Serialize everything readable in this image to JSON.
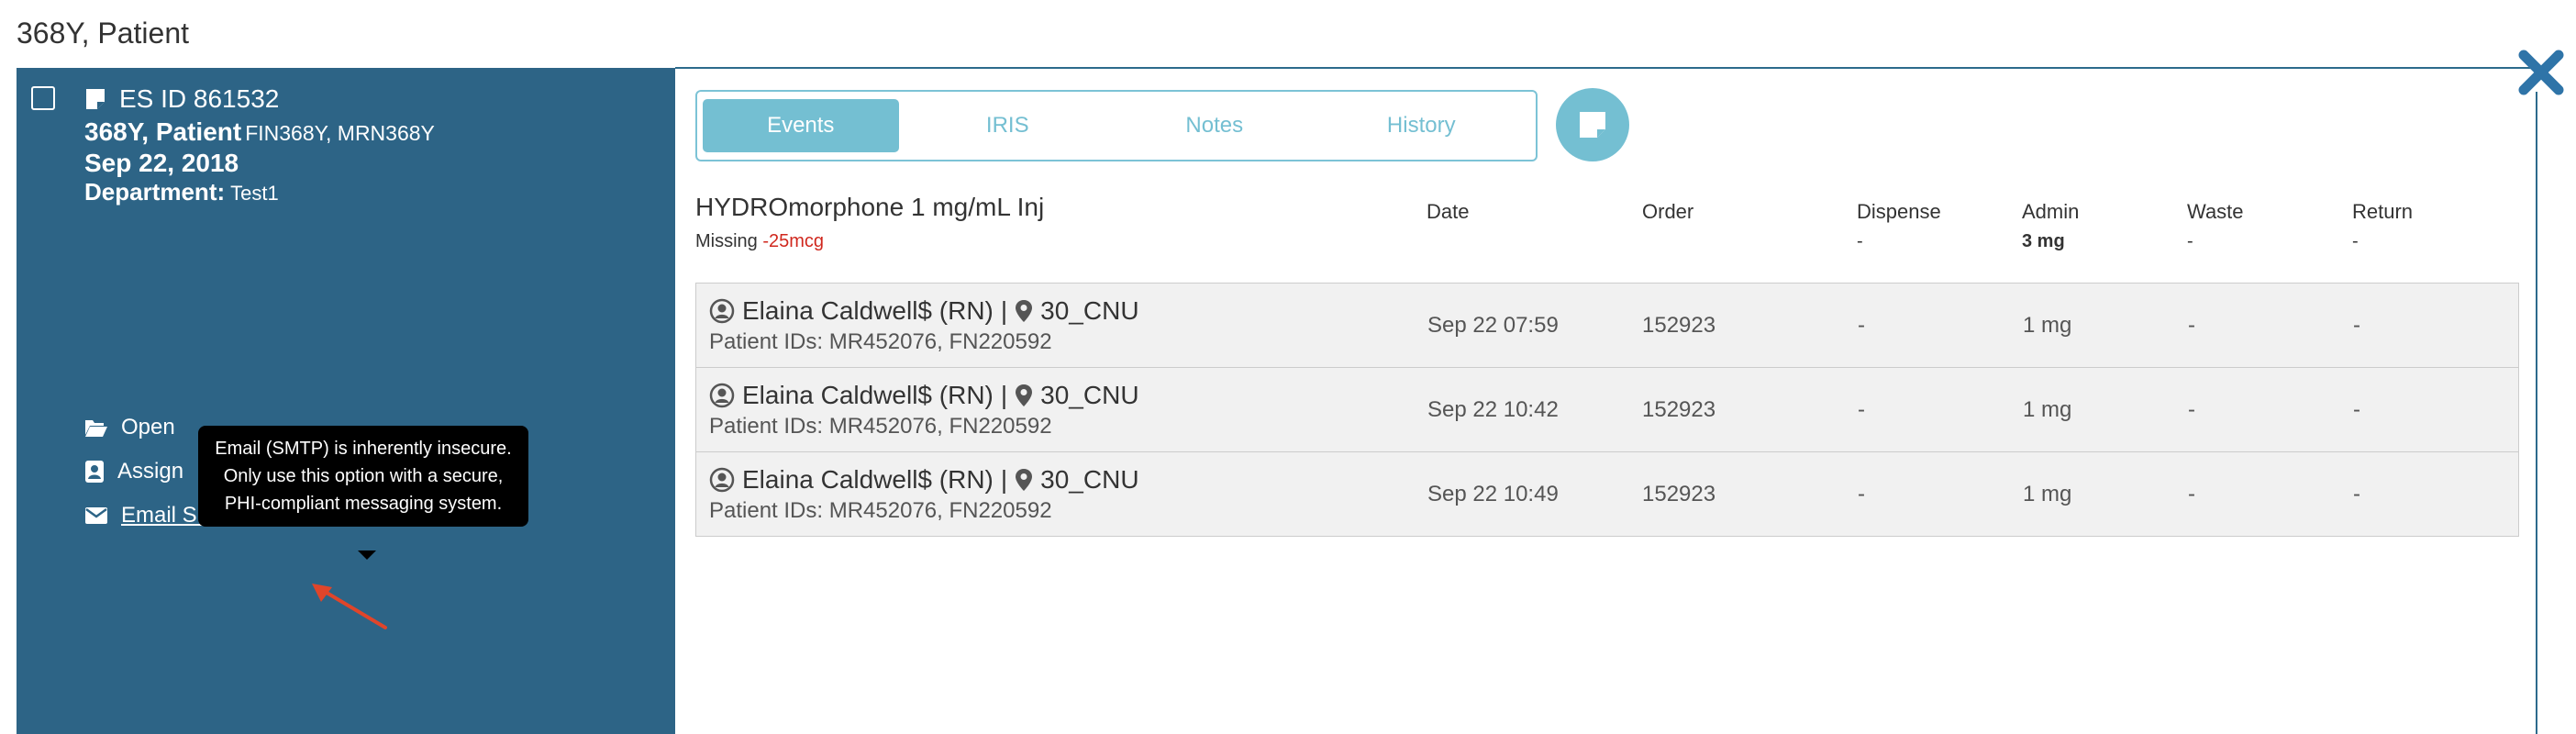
{
  "page": {
    "title": "368Y, Patient"
  },
  "sidebar": {
    "es_id": "ES ID 861532",
    "patient_name": "368Y, Patient",
    "patient_ids": "FIN368Y, MRN368Y",
    "date": "Sep 22, 2018",
    "department_label": "Department:",
    "department_value": "Test1",
    "actions": [
      {
        "label": "Open",
        "icon": "folder-open-icon"
      },
      {
        "label": "Assign",
        "icon": "assign-icon"
      },
      {
        "label": "Email Summary",
        "icon": "envelope-icon"
      }
    ],
    "tooltip": "Email (SMTP) is inherently insecure. Only use this option with a secure, PHI-compliant messaging system."
  },
  "tabs": [
    {
      "label": "Events",
      "active": true
    },
    {
      "label": "IRIS",
      "active": false
    },
    {
      "label": "Notes",
      "active": false
    },
    {
      "label": "History",
      "active": false
    }
  ],
  "medication": {
    "name": "HYDROmorphone 1 mg/mL Inj",
    "missing_label": "Missing",
    "missing_value": "-25mcg"
  },
  "columns": {
    "date": "Date",
    "order": "Order",
    "dispense": "Dispense",
    "admin": "Admin",
    "waste": "Waste",
    "return": "Return"
  },
  "summary": {
    "dispense": "-",
    "admin": "3 mg",
    "waste": "-",
    "return": "-"
  },
  "events": [
    {
      "user": "Elaina Caldwell$ (RN)",
      "separator": "|",
      "location": "30_CNU",
      "patient_ids": "Patient IDs: MR452076, FN220592",
      "date": "Sep 22 07:59",
      "order": "152923",
      "dispense": "-",
      "admin": "1 mg",
      "waste": "-",
      "return": "-"
    },
    {
      "user": "Elaina Caldwell$ (RN)",
      "separator": "|",
      "location": "30_CNU",
      "patient_ids": "Patient IDs: MR452076, FN220592",
      "date": "Sep 22 10:42",
      "order": "152923",
      "dispense": "-",
      "admin": "1 mg",
      "waste": "-",
      "return": "-"
    },
    {
      "user": "Elaina Caldwell$ (RN)",
      "separator": "|",
      "location": "30_CNU",
      "patient_ids": "Patient IDs: MR452076, FN220592",
      "date": "Sep 22 10:49",
      "order": "152923",
      "dispense": "-",
      "admin": "1 mg",
      "waste": "-",
      "return": "-"
    }
  ],
  "colors": {
    "sidebar_bg": "#2d6486",
    "accent": "#74bfd2",
    "close_x": "#2f74a8",
    "missing_red": "#d0281e",
    "annotation_arrow": "#e0452a"
  }
}
